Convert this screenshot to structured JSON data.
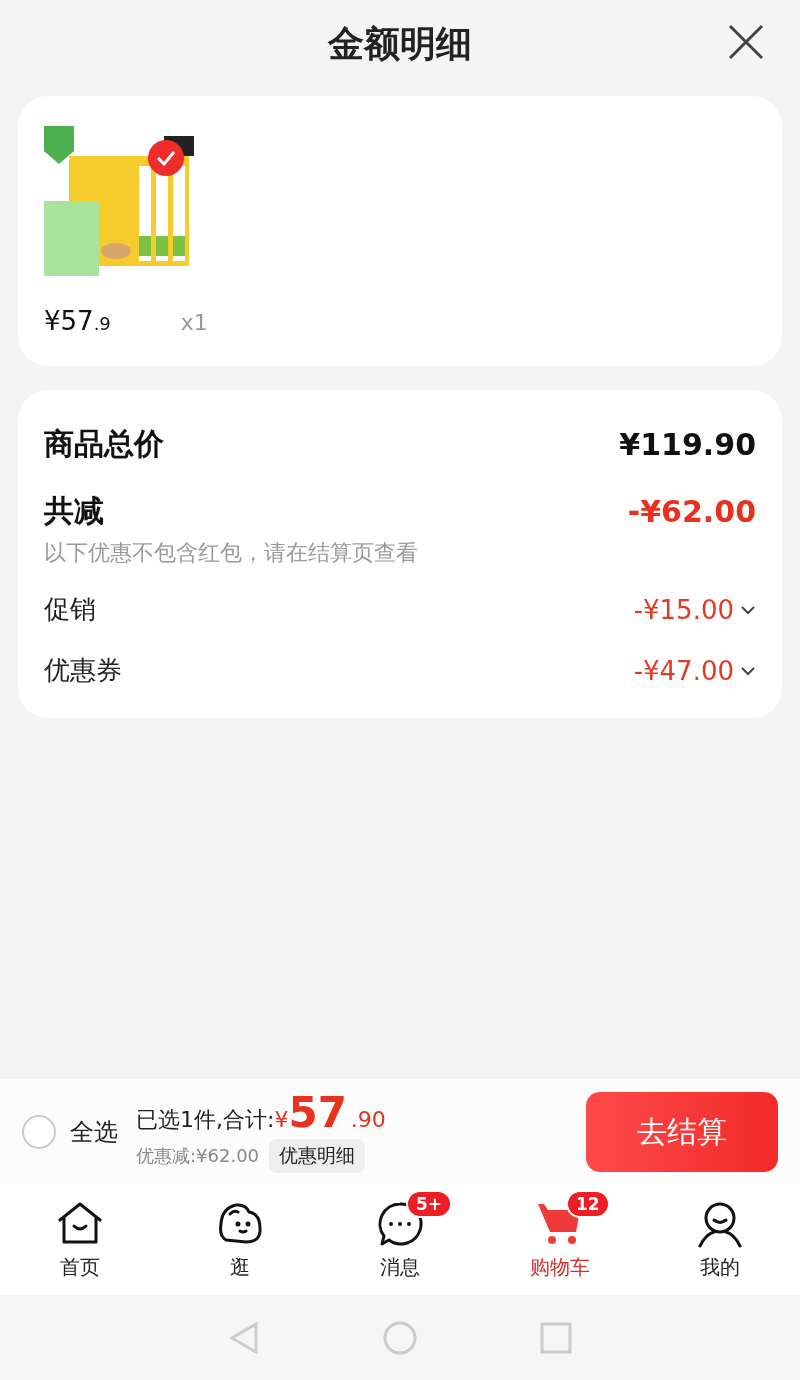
{
  "header": {
    "title": "金额明细"
  },
  "products": [
    {
      "kind": "picture",
      "selected": true,
      "price_main": "¥57",
      "price_decimal": ".9",
      "quantity": "x1"
    }
  ],
  "summary": {
    "total_label": "商品总价",
    "total_value": "¥119.90",
    "discount_label": "共减",
    "discount_value": "-¥62.00",
    "note": "以下优惠不包含红包，请在结算页查看",
    "lines": [
      {
        "label": "促销",
        "value": "-¥15.00",
        "expanded": false
      },
      {
        "label": "优惠券",
        "value": "-¥47.00",
        "expanded": false
      }
    ]
  },
  "checkout_bar": {
    "select_all": {
      "label": "全选",
      "checked": false
    },
    "selected_text": "已选1件,合计:",
    "currency": "¥",
    "amount_main": "57",
    "amount_decimal": ".90",
    "savings": "优惠减:¥62.00",
    "details_button": "优惠明细",
    "checkout_button": "去结算"
  },
  "tab_bar": [
    {
      "kind": "home",
      "label": "首页",
      "selected": false
    },
    {
      "kind": "stroll",
      "label": "逛",
      "selected": false
    },
    {
      "kind": "message",
      "label": "消息",
      "selected": false,
      "badge": "5+"
    },
    {
      "kind": "cart",
      "label": "购物车",
      "selected": true,
      "badge": "12"
    },
    {
      "kind": "me",
      "label": "我的",
      "selected": false
    }
  ]
}
